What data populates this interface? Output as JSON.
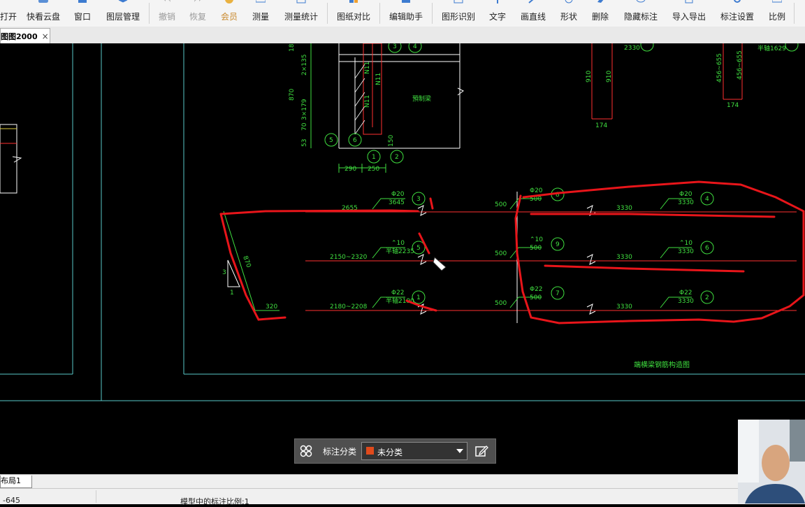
{
  "toolbar": {
    "items": [
      {
        "label": "打开",
        "icon": "folder-open-icon"
      },
      {
        "label": "快看云盘",
        "icon": "cloud-icon"
      },
      {
        "label": "窗口",
        "icon": "window-icon"
      },
      {
        "label": "图层管理",
        "icon": "layers-icon"
      },
      {
        "label": "撤销",
        "icon": "undo-icon"
      },
      {
        "label": "恢复",
        "icon": "redo-icon"
      },
      {
        "label": "会员",
        "icon": "vip-icon"
      },
      {
        "label": "测量",
        "icon": "ruler-icon"
      },
      {
        "label": "测量统计",
        "icon": "measure-stats-icon"
      },
      {
        "label": "图纸对比",
        "icon": "compare-icon"
      },
      {
        "label": "编辑助手",
        "icon": "edit-assistant-icon"
      },
      {
        "label": "图形识别",
        "icon": "shape-recognition-icon"
      },
      {
        "label": "文字",
        "icon": "text-icon"
      },
      {
        "label": "画直线",
        "icon": "line-icon"
      },
      {
        "label": "形状",
        "icon": "shape-icon"
      },
      {
        "label": "删除",
        "icon": "eraser-icon"
      },
      {
        "label": "隐藏标注",
        "icon": "eye-icon"
      },
      {
        "label": "导入导出",
        "icon": "import-export-icon"
      },
      {
        "label": "标注设置",
        "icon": "gear-icon"
      },
      {
        "label": "比例",
        "icon": "scale-ruler-icon"
      }
    ]
  },
  "document_tab": {
    "label": "图图2000",
    "close": "×"
  },
  "drawing": {
    "dims_top": [
      "18",
      "2×135",
      "870",
      "3×179",
      "70",
      "53",
      "290",
      "250",
      "150"
    ],
    "labels_top": [
      "預制梁",
      "N11",
      "N11",
      "N11"
    ],
    "circled_top": [
      "3",
      "4",
      "5",
      "6",
      "1",
      "2"
    ],
    "right_top": [
      "2330",
      "910",
      "910",
      "174",
      "456~655",
      "456~655",
      "174",
      "半轴1629"
    ],
    "rows": [
      {
        "left": "2655",
        "spec": "Φ20",
        "len": "3645",
        "num": "3",
        "mid": "500",
        "spec2": "Φ20",
        "len2": "500",
        "num2": "8",
        "right": "3330",
        "spec3": "Φ20",
        "len3": "3330",
        "num3": "4"
      },
      {
        "left": "2150~2320",
        "spec": "⌃10",
        "len": "半轴2235",
        "num": "5",
        "mid": "500",
        "spec2": "⌃10",
        "len2": "500",
        "num2": "9",
        "right": "3330",
        "spec3": "⌃10",
        "len3": "3330",
        "num3": "6"
      },
      {
        "left": "2180~2208",
        "spec": "Φ22",
        "len": "半轴2190",
        "num": "1",
        "mid": "500",
        "spec2": "Φ22",
        "len2": "500",
        "num2": "7",
        "right": "3330",
        "spec3": "Φ22",
        "len3": "3330",
        "num3": "2"
      }
    ],
    "left_dims": [
      "870",
      "320",
      "1",
      "3"
    ],
    "caption": "端横梁钢筋构造图"
  },
  "layout_tab": "布局1",
  "status": {
    "coord": "-645",
    "scale_text": "模型中的标注比例:1"
  },
  "annotation_panel": {
    "label": "标注分类",
    "value": "未分类",
    "swatch_color": "#e04a1c"
  }
}
